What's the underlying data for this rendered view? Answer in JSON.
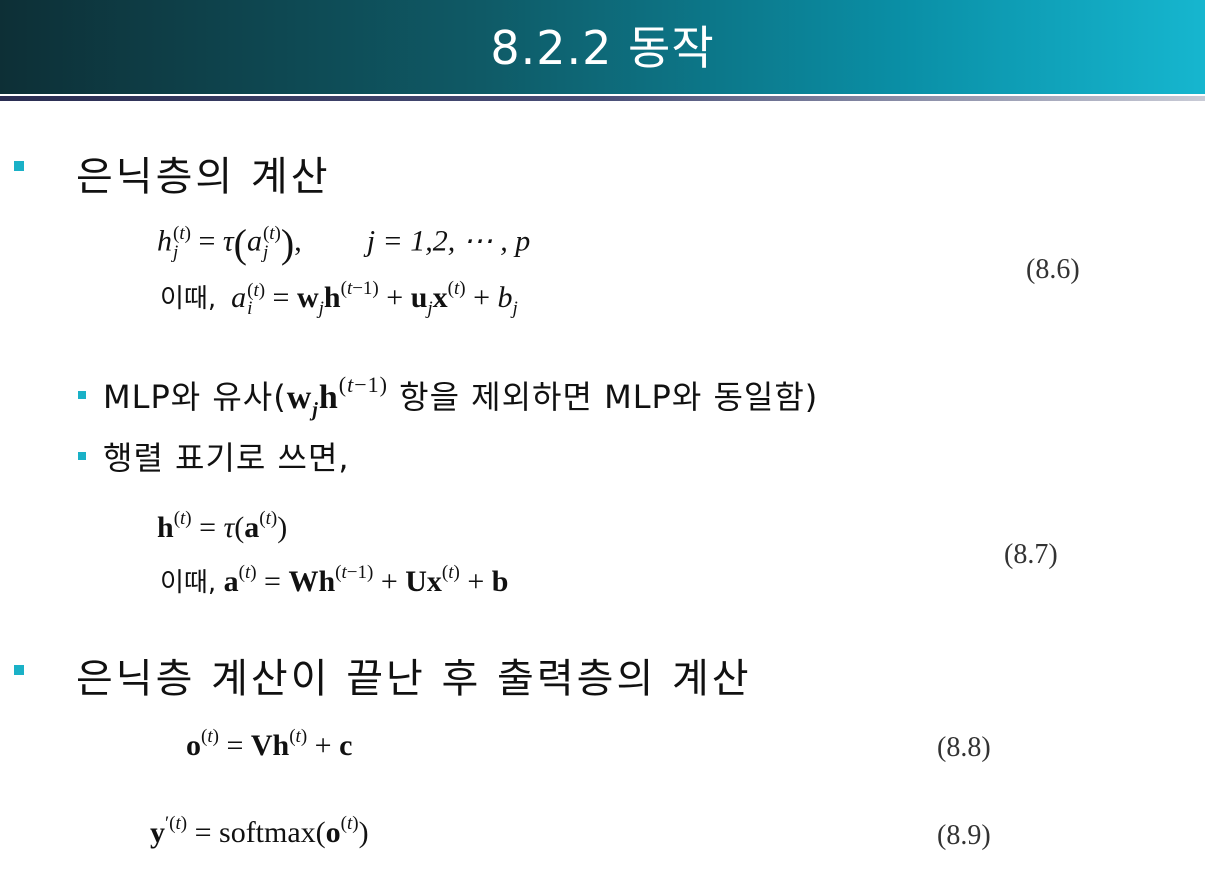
{
  "header": {
    "title": "8.2.2 동작"
  },
  "bullets": {
    "hidden_calc": "은닉층의 계산",
    "after_hidden": "은닉층 계산이 끝난 후 출력층의 계산"
  },
  "sub_bullets": {
    "mlp_prefix": "MLP와 유사(",
    "mlp_suffix": " 항을 제외하면 MLP와 동일함)",
    "matrix": "행렬 표기로 쓰면,"
  },
  "equations": {
    "eq6_line1_range": "j = 1,2, ⋯ , p",
    "ittae": "이때,",
    "eq6_number": "(8.6)",
    "eq7_number": "(8.7)",
    "eq8_number": "(8.8)",
    "eq9_number": "(8.9)",
    "softmax": "softmax"
  },
  "colors": {
    "header_gradient_start": "#0d2f36",
    "header_gradient_end": "#16b6cf",
    "bullet": "#1ab1c7"
  }
}
